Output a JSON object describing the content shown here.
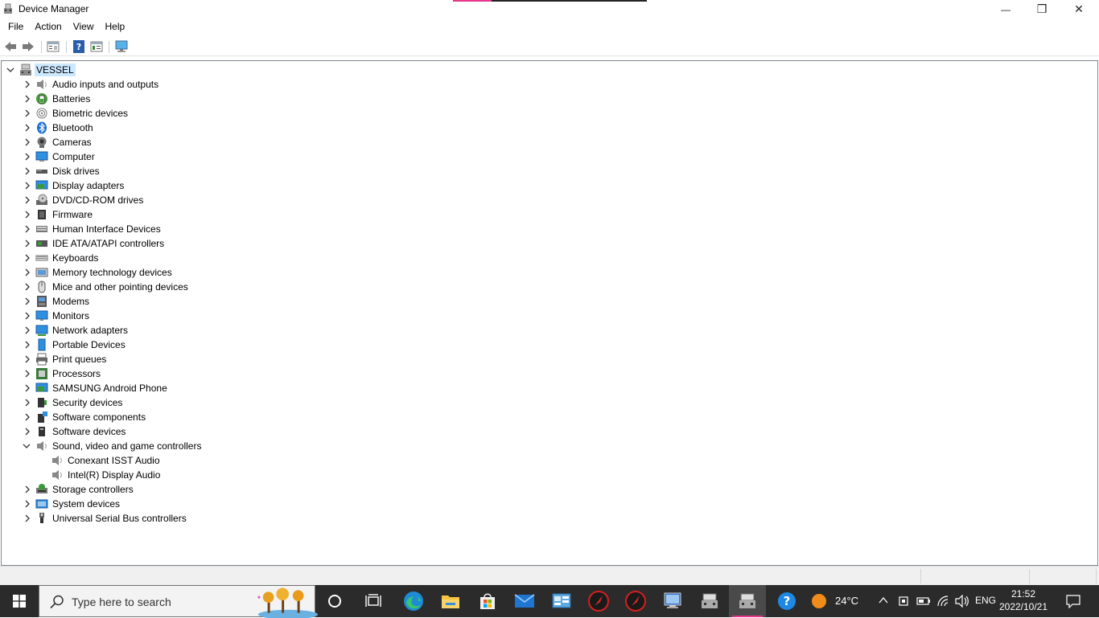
{
  "window": {
    "title": "Device Manager",
    "minimize_glyph": "—",
    "maximize_glyph": "❒",
    "close_glyph": "✕"
  },
  "menu": [
    "File",
    "Action",
    "View",
    "Help"
  ],
  "toolbar": {
    "icons": [
      "back-arrow-icon",
      "forward-arrow-icon",
      "properties-icon",
      "help-icon",
      "view-pane-icon",
      "scan-hardware-monitor-icon"
    ]
  },
  "tree": {
    "root": "VESSEL",
    "categories": [
      {
        "label": "Audio inputs and outputs",
        "icon": "speaker-icon",
        "expanded": false
      },
      {
        "label": "Batteries",
        "icon": "battery-icon",
        "expanded": false
      },
      {
        "label": "Biometric devices",
        "icon": "fingerprint-icon",
        "expanded": false
      },
      {
        "label": "Bluetooth",
        "icon": "bluetooth-icon",
        "expanded": false
      },
      {
        "label": "Cameras",
        "icon": "camera-icon",
        "expanded": false
      },
      {
        "label": "Computer",
        "icon": "computer-icon",
        "expanded": false
      },
      {
        "label": "Disk drives",
        "icon": "disk-drive-icon",
        "expanded": false
      },
      {
        "label": "Display adapters",
        "icon": "display-adapter-icon",
        "expanded": false
      },
      {
        "label": "DVD/CD-ROM drives",
        "icon": "dvd-drive-icon",
        "expanded": false
      },
      {
        "label": "Firmware",
        "icon": "firmware-chip-icon",
        "expanded": false
      },
      {
        "label": "Human Interface Devices",
        "icon": "hid-keyboard-icon",
        "expanded": false
      },
      {
        "label": "IDE ATA/ATAPI controllers",
        "icon": "ide-controller-icon",
        "expanded": false
      },
      {
        "label": "Keyboards",
        "icon": "keyboard-icon",
        "expanded": false
      },
      {
        "label": "Memory technology devices",
        "icon": "memory-icon",
        "expanded": false
      },
      {
        "label": "Mice and other pointing devices",
        "icon": "mouse-icon",
        "expanded": false
      },
      {
        "label": "Modems",
        "icon": "modem-icon",
        "expanded": false
      },
      {
        "label": "Monitors",
        "icon": "monitor-icon",
        "expanded": false
      },
      {
        "label": "Network adapters",
        "icon": "network-adapter-icon",
        "expanded": false
      },
      {
        "label": "Portable Devices",
        "icon": "portable-device-icon",
        "expanded": false
      },
      {
        "label": "Print queues",
        "icon": "printer-icon",
        "expanded": false
      },
      {
        "label": "Processors",
        "icon": "processor-icon",
        "expanded": false
      },
      {
        "label": "SAMSUNG Android Phone",
        "icon": "android-phone-icon",
        "expanded": false
      },
      {
        "label": "Security devices",
        "icon": "security-device-icon",
        "expanded": false
      },
      {
        "label": "Software components",
        "icon": "software-component-icon",
        "expanded": false
      },
      {
        "label": "Software devices",
        "icon": "software-device-icon",
        "expanded": false
      },
      {
        "label": "Sound, video and game controllers",
        "icon": "speaker-icon",
        "expanded": true,
        "children": [
          "Conexant ISST Audio",
          "Intel(R) Display Audio"
        ]
      },
      {
        "label": "Storage controllers",
        "icon": "storage-controller-icon",
        "expanded": false
      },
      {
        "label": "System devices",
        "icon": "system-device-icon",
        "expanded": false
      },
      {
        "label": "Universal Serial Bus controllers",
        "icon": "usb-icon",
        "expanded": false
      }
    ]
  },
  "taskbar": {
    "search_placeholder": "Type here to search",
    "apps": [
      "cortana-circle-icon",
      "task-view-icon",
      "edge-icon",
      "file-explorer-icon",
      "microsoft-store-icon",
      "mail-icon",
      "control-panel-icon",
      "red-app-icon",
      "red-app-icon",
      "remote-desktop-icon",
      "device-manager-icon",
      "device-manager-active-icon",
      "help-icon"
    ],
    "weather": "24°C",
    "language": "ENG",
    "time": "21:52",
    "date": "2022/10/21"
  },
  "colors": {
    "selection": "#cce8ff",
    "taskbar": "#2b2b2b",
    "accent_pink": "#e8358a",
    "blue_icon": "#2f7fd6"
  }
}
